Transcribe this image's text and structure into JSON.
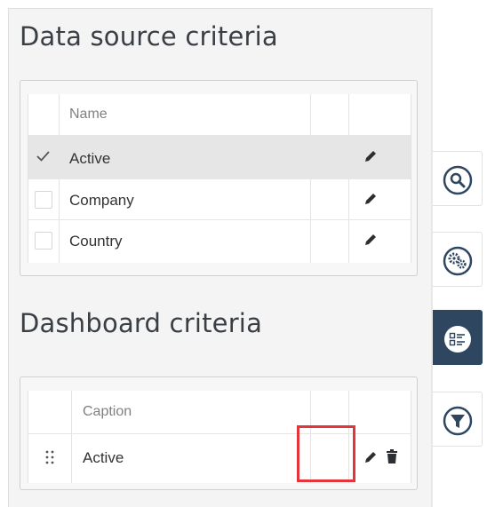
{
  "datasource": {
    "title": "Data source criteria",
    "header": "Name",
    "rows": [
      {
        "label": "Active",
        "checked": true,
        "selected": true
      },
      {
        "label": "Company",
        "checked": false,
        "selected": false
      },
      {
        "label": "Country",
        "checked": false,
        "selected": false
      }
    ]
  },
  "dashboard": {
    "title": "Dashboard criteria",
    "header": "Caption",
    "rows": [
      {
        "label": "Active"
      }
    ]
  },
  "sidebar": {
    "buttons": [
      {
        "name": "search",
        "icon": "search-icon",
        "active": false
      },
      {
        "name": "settings",
        "icon": "gears-icon",
        "active": false
      },
      {
        "name": "criteria",
        "icon": "criteria-list-icon",
        "active": true
      },
      {
        "name": "filter",
        "icon": "filter-icon",
        "active": false
      }
    ]
  },
  "colors": {
    "accent": "#2e4660",
    "highlight": "#e4353a",
    "selected_row": "#e6e6e6"
  }
}
